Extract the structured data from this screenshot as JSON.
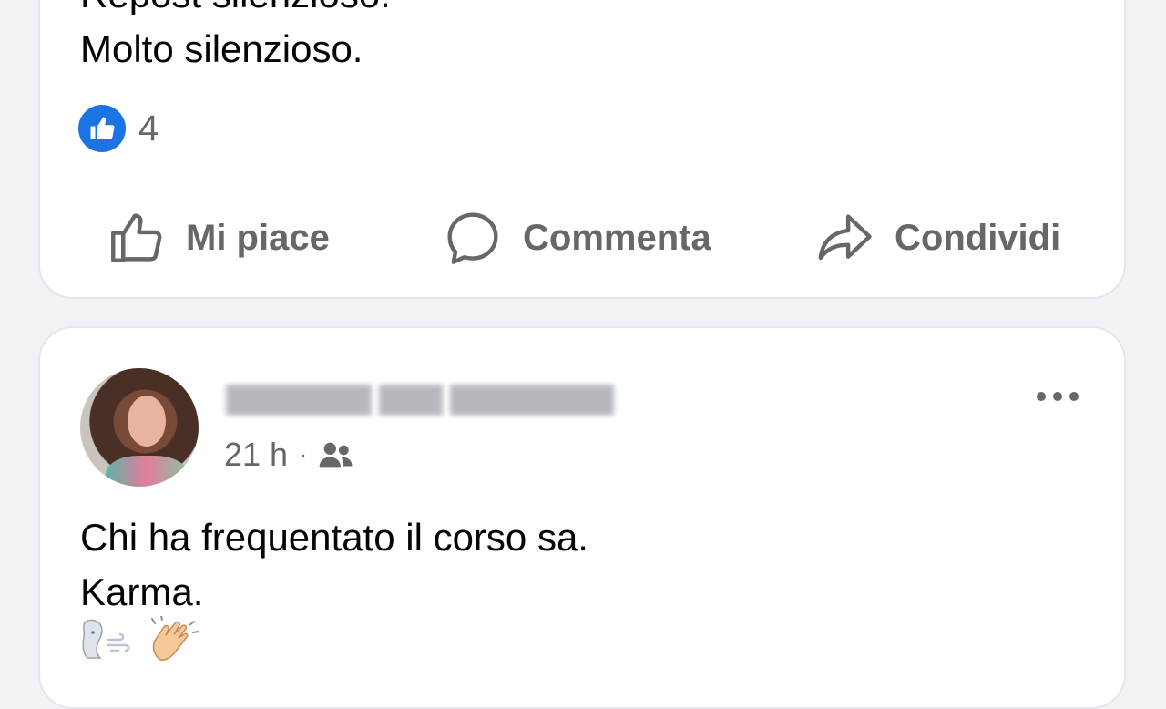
{
  "post1": {
    "text_lines": [
      "Repost silenzioso.",
      "Molto silenzioso."
    ],
    "reaction_icon": "like-icon",
    "reaction_count": "4",
    "actions": {
      "like_label": "Mi piace",
      "comment_label": "Commenta",
      "share_label": "Condividi"
    }
  },
  "post2": {
    "author_name_blurred": true,
    "time": "21 h",
    "separator": "·",
    "audience_icon": "friends-icon",
    "text_lines": [
      "Chi ha frequentato il corso sa.",
      "Karma."
    ],
    "emoji": [
      "wind-face-emoji",
      "clapping-hands-emoji"
    ]
  },
  "colors": {
    "accent": "#1b74e4",
    "secondary_text": "#65676b",
    "card_border": "#e4e6eb",
    "background": "#f0f2f5"
  }
}
